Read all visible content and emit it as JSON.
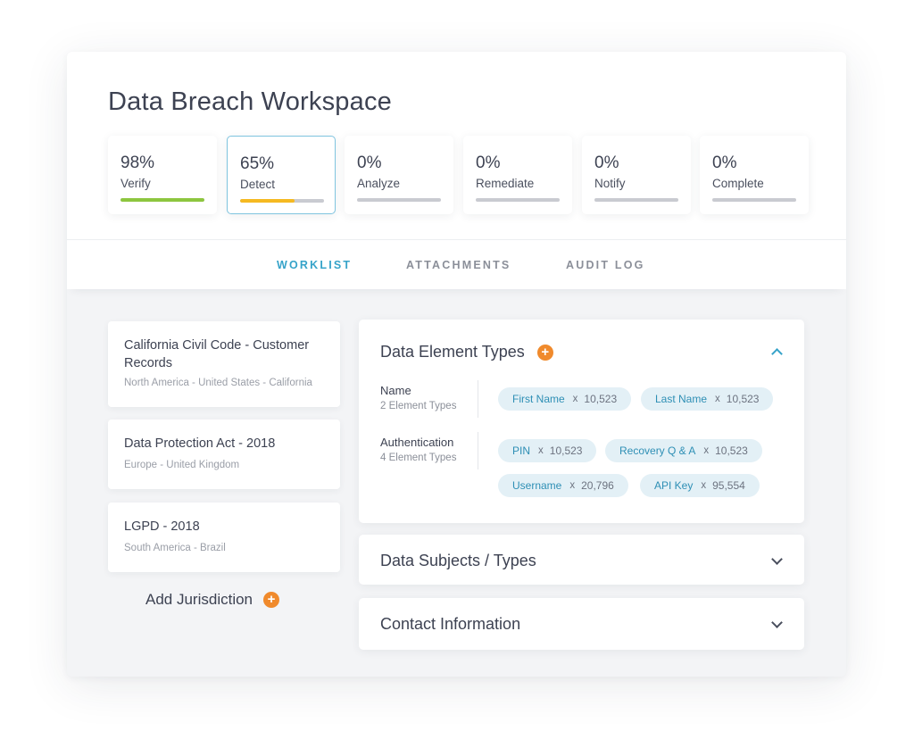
{
  "header": {
    "title": "Data Breach Workspace"
  },
  "stages": [
    {
      "percent": "98%",
      "label": "Verify",
      "progress": 1.0,
      "color": "#8dc63f"
    },
    {
      "percent": "65%",
      "label": "Detect",
      "progress": 0.65,
      "color": "#f5b921"
    },
    {
      "percent": "0%",
      "label": "Analyze",
      "progress": 0,
      "color": "#c9cbd1"
    },
    {
      "percent": "0%",
      "label": "Remediate",
      "progress": 0,
      "color": "#c9cbd1"
    },
    {
      "percent": "0%",
      "label": "Notify",
      "progress": 0,
      "color": "#c9cbd1"
    },
    {
      "percent": "0%",
      "label": "Complete",
      "progress": 0,
      "color": "#c9cbd1"
    }
  ],
  "tabs": [
    {
      "label": "WORKLIST",
      "active": true
    },
    {
      "label": "ATTACHMENTS",
      "active": false
    },
    {
      "label": "AUDIT LOG",
      "active": false
    }
  ],
  "jurisdictions": [
    {
      "title": "California Civil Code - Customer Records",
      "region": "North America - United States - California"
    },
    {
      "title": "Data Protection Act - 2018",
      "region": "Europe - United Kingdom"
    },
    {
      "title": "LGPD - 2018",
      "region": "South America - Brazil"
    }
  ],
  "add_jurisdiction_label": "Add Jurisdiction",
  "panels": {
    "data_element_types": {
      "title": "Data Element Types",
      "groups": [
        {
          "name": "Name",
          "count": "2 Element Types",
          "chips": [
            {
              "label": "First Name",
              "count": "10,523"
            },
            {
              "label": "Last Name",
              "count": "10,523"
            }
          ]
        },
        {
          "name": "Authentication",
          "count": "4 Element Types",
          "chips": [
            {
              "label": "PIN",
              "count": "10,523"
            },
            {
              "label": "Recovery Q & A",
              "count": "10,523"
            },
            {
              "label": "Username",
              "count": "20,796"
            },
            {
              "label": "API Key",
              "count": "95,554"
            }
          ]
        }
      ]
    },
    "data_subjects": {
      "title": "Data Subjects / Types"
    },
    "contact_information": {
      "title": "Contact Information"
    }
  },
  "colors": {
    "accent": "#36a3c9",
    "plus_badge": "#f08a2c",
    "chip_bg": "#e3f0f6",
    "chip_text": "#2e8fb5"
  },
  "icons": {
    "plus": "+",
    "chip_separator": "x"
  }
}
